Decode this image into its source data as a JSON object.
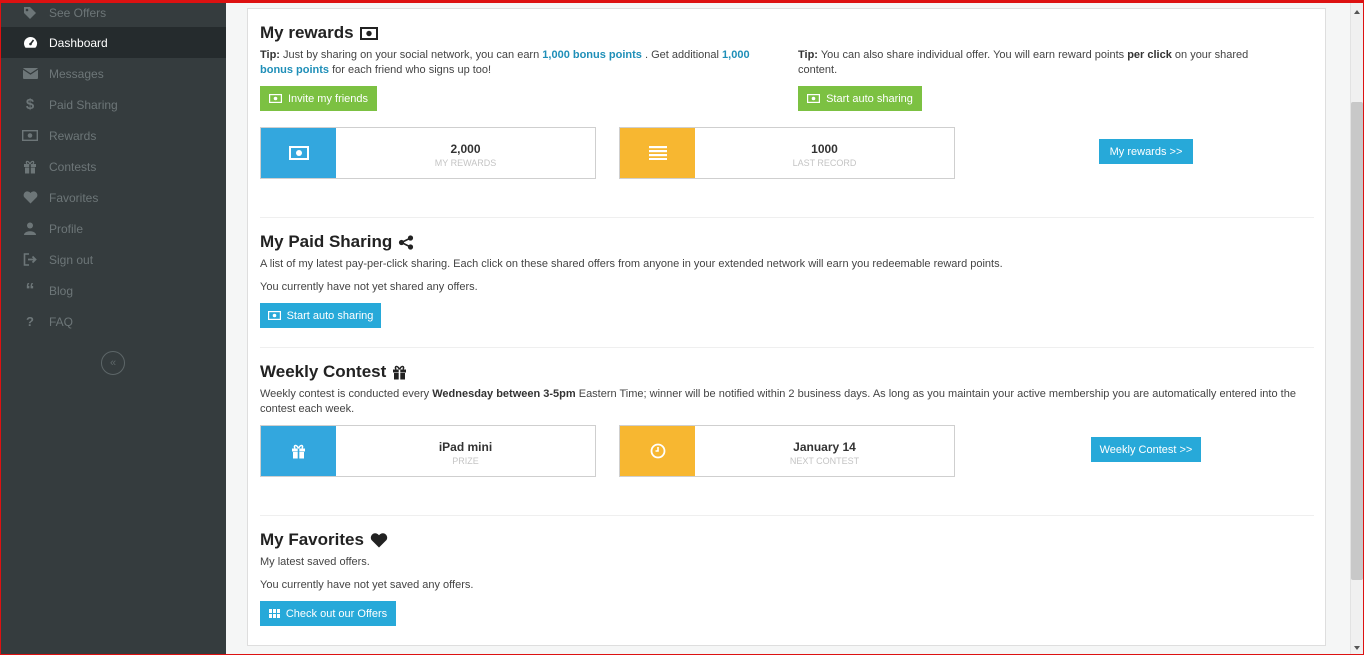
{
  "sidebar": {
    "items": [
      {
        "label": "See Offers",
        "icon": "tag-icon"
      },
      {
        "label": "Dashboard",
        "icon": "dashboard-icon"
      },
      {
        "label": "Messages",
        "icon": "envelope-icon"
      },
      {
        "label": "Paid Sharing",
        "icon": "dollar-icon"
      },
      {
        "label": "Rewards",
        "icon": "money-icon"
      },
      {
        "label": "Contests",
        "icon": "gift-icon"
      },
      {
        "label": "Favorites",
        "icon": "heart-icon"
      },
      {
        "label": "Profile",
        "icon": "user-icon"
      },
      {
        "label": "Sign out",
        "icon": "signout-icon"
      },
      {
        "label": "Blog",
        "icon": "quote-icon"
      },
      {
        "label": "FAQ",
        "icon": "question-icon"
      }
    ],
    "active": "Dashboard",
    "collapse_glyph": "«"
  },
  "rewards": {
    "title": "My rewards",
    "tip1": {
      "prefix": "Tip:",
      "part1": " Just by sharing on your social network, you can earn ",
      "bold1": "1,000 bonus points",
      "part2": " . Get additional ",
      "bold2a": "1,000",
      "bold2b": "bonus points",
      "part3": " for each friend who signs up too!"
    },
    "tip2": {
      "prefix": "Tip:",
      "part1": " You can also share individual offer. You will earn reward points ",
      "bold": "per click",
      "part2": " on your shared",
      "line2": "content."
    },
    "invite_button": "Invite my friends",
    "auto_share_button": "Start auto sharing",
    "stat1": {
      "value": "2,000",
      "label": "MY REWARDS"
    },
    "stat2": {
      "value": "1000",
      "label": "LAST RECORD"
    },
    "more_button": "My rewards >>"
  },
  "paid_sharing": {
    "title": "My Paid Sharing",
    "description": "A list of my latest pay-per-click sharing. Each click on these shared offers from anyone in your extended network will earn you redeemable reward points.",
    "empty": "You currently have not yet shared any offers.",
    "button": "Start auto sharing"
  },
  "contest": {
    "title": "Weekly Contest",
    "desc_part1": "Weekly contest is conducted every ",
    "desc_bold": "Wednesday between 3-5pm",
    "desc_part2": " Eastern Time; winner will be notified within 2 business days. As long as you maintain your active membership you are automatically entered into the",
    "desc_line2": "contest each week.",
    "stat1": {
      "value": "iPad mini",
      "label": "PRIZE"
    },
    "stat2": {
      "value": "January 14",
      "label": "NEXT CONTEST"
    },
    "button": "Weekly Contest >>"
  },
  "favorites": {
    "title": "My Favorites",
    "description": "My latest saved offers.",
    "empty": "You currently have not yet saved any offers.",
    "button": "Check out our Offers"
  },
  "colors": {
    "sidebar_bg": "#353c3e",
    "sidebar_active": "#252b2d",
    "green": "#7cc142",
    "blue": "#27a9d9",
    "orange": "#f7b731",
    "link_blue": "#1f8fb8"
  }
}
